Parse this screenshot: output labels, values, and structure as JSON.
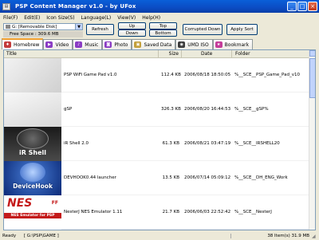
{
  "window": {
    "title": "PSP Content Manager v1.0 - by UFox",
    "icon": "app-icon"
  },
  "menu": [
    "File(F)",
    "Edit(E)",
    "Icon Size(S)",
    "Language(L)",
    "View(V)",
    "Help(H)"
  ],
  "toolbar": {
    "drive": "G: [Removable Disk]",
    "free_space": "Free Space : 309.6 MB",
    "refresh_label": "Refresh",
    "up_label": "Up",
    "down_label": "Down",
    "top_label": "Top",
    "bottom_label": "Bottom",
    "corrupted_label": "Corrupted Down",
    "apply_label": "Apply Sort"
  },
  "tabs": [
    {
      "label": "Homebrew",
      "icon": "homebrew-icon",
      "color": "#c43c3c"
    },
    {
      "label": "Video",
      "icon": "video-icon",
      "color": "#8a3cc4"
    },
    {
      "label": "Music",
      "icon": "music-icon",
      "color": "#8a3cc4"
    },
    {
      "label": "Photo",
      "icon": "photo-icon",
      "color": "#8a3cc4"
    },
    {
      "label": "Saved Data",
      "icon": "saved-data-icon",
      "color": "#c4a03c"
    },
    {
      "label": "UMD ISO",
      "icon": "umd-iso-icon",
      "color": "#3c3c3c"
    },
    {
      "label": "Bookmark",
      "icon": "bookmark-icon",
      "color": "#c43c9a"
    }
  ],
  "columns": {
    "title": "Title",
    "size": "Size",
    "date": "Date",
    "folder": "Folder"
  },
  "rows": [
    {
      "title": "PSP WiFi Game Pad v1.0",
      "size": "112.4 KB",
      "date": "2006/08/18 18:50:05",
      "folder": "%__SCE__PSP_Game_Pad_v10"
    },
    {
      "title": "gSP",
      "size": "326.3 KB",
      "date": "2006/08/20 16:44:53",
      "folder": "%__SCE__gSP%"
    },
    {
      "title": "iR Shell 2.0",
      "size": "61.3 KB",
      "date": "2006/08/21 03:47:19",
      "folder": "%__SCE__IRSHELL20"
    },
    {
      "title": "DEVHOOK0.44 launcher",
      "size": "13.5 KB",
      "date": "2006/07/14 05:09:12",
      "folder": "%__SCE__DH_ENG_Work"
    },
    {
      "title": "NesterJ NES Emulator 1.11",
      "size": "21.7 KB",
      "date": "2006/06/03 22:52:42",
      "folder": "%__SCE__NesterJ"
    }
  ],
  "thumbs": {
    "irshell": "iR Shell",
    "devicehook": "DeviceHook",
    "nes": "NES",
    "nes_sub": "NES Emulator for PSP",
    "nes_fire": "FF"
  },
  "status": {
    "left_label": "Ready",
    "path": "[ G:\\PSP\\GAME ]",
    "right": "38 Item(s) 31.9 MB"
  }
}
